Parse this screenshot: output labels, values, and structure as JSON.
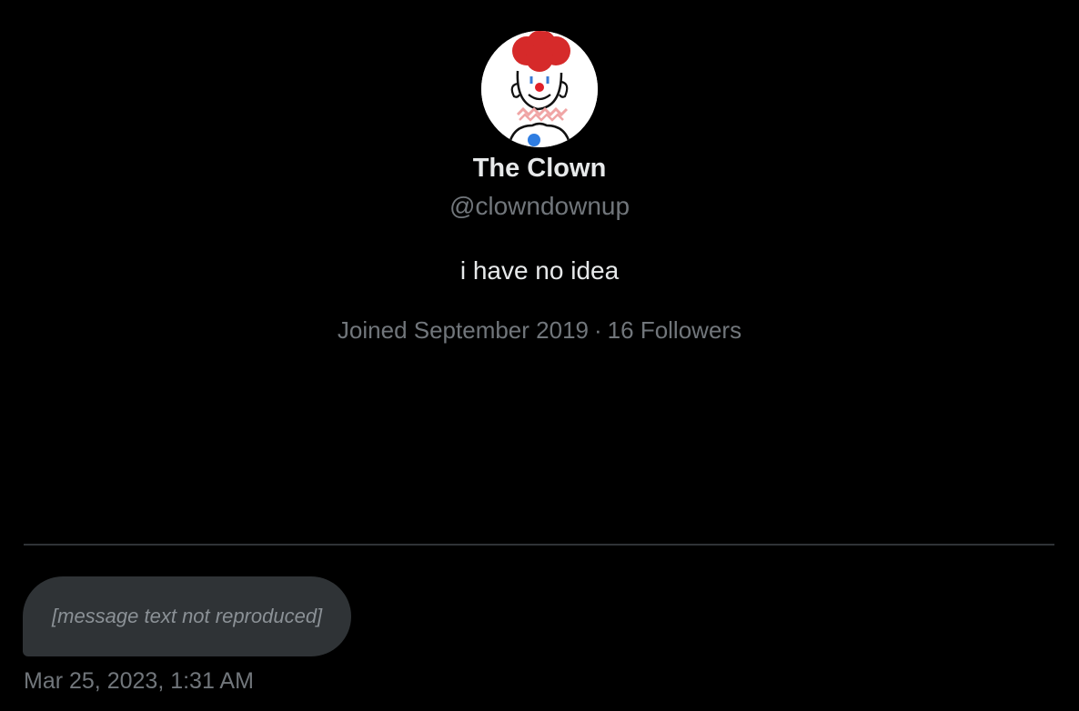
{
  "profile": {
    "display_name": "The Clown",
    "handle": "@clowndownup",
    "bio": "i have no idea",
    "joined": "Joined September 2019",
    "separator": "·",
    "followers": "16 Followers",
    "avatar_icon": "clown-avatar-icon"
  },
  "message": {
    "text_omitted_note": "[message text not reproduced]",
    "timestamp": "Mar 25, 2023, 1:31 AM"
  },
  "colors": {
    "background": "#000000",
    "primary_text": "#e7e9ea",
    "secondary_text": "#71767b",
    "bubble": "#2f3336",
    "divider": "#2f3336"
  }
}
